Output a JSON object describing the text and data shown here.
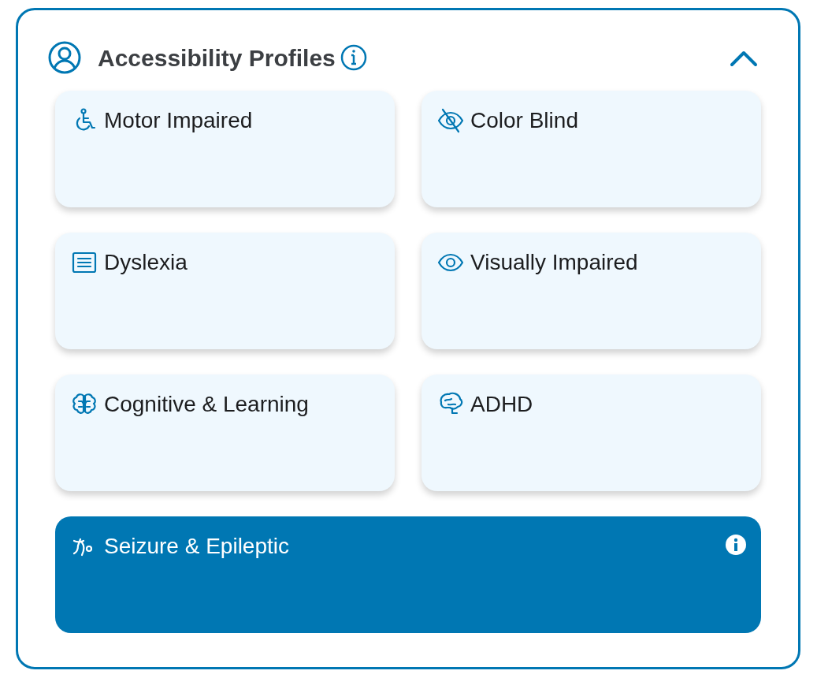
{
  "panel": {
    "title": "Accessibility Profiles",
    "expanded": true
  },
  "profiles": [
    {
      "label": "Motor Impaired",
      "selected": false
    },
    {
      "label": "Color Blind",
      "selected": false
    },
    {
      "label": "Dyslexia",
      "selected": false
    },
    {
      "label": "Visually Impaired",
      "selected": false
    },
    {
      "label": "Cognitive & Learning",
      "selected": false
    },
    {
      "label": "ADHD",
      "selected": false
    },
    {
      "label": "Seizure & Epileptic",
      "selected": true
    }
  ]
}
